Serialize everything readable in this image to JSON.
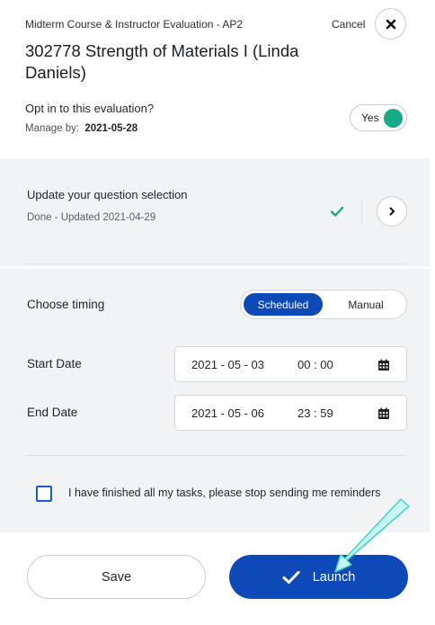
{
  "header": {
    "evaluation_name": "Midterm Course & Instructor Evaluation - AP2",
    "cancel_label": "Cancel",
    "close_icon": "close-icon",
    "course_title": "302778 Strength of Materials I (Linda Daniels)",
    "optin_question": "Opt in to this evaluation?",
    "manage_by_label": "Manage by:",
    "manage_by_date": "2021-05-28",
    "optin_toggle_label": "Yes",
    "optin_toggle_on": true
  },
  "question_selection": {
    "title": "Update your question selection",
    "status": "Done - Updated 2021-04-29",
    "status_icon": "check-icon",
    "nav_icon": "chevron-right-icon"
  },
  "timing": {
    "label": "Choose timing",
    "options": [
      "Scheduled",
      "Manual"
    ],
    "selected": "Scheduled"
  },
  "start": {
    "label": "Start Date",
    "date": "2021 - 05 - 03",
    "time": "00 : 00"
  },
  "end": {
    "label": "End Date",
    "date": "2021 - 05 - 06",
    "time": "23 : 59"
  },
  "reminder": {
    "label": "I have finished all my tasks, please stop sending me reminders",
    "checked": false
  },
  "footer": {
    "save_label": "Save",
    "launch_label": "Launch"
  },
  "colors": {
    "primary": "#0e49b8",
    "toggle_on": "#18a987",
    "check_green": "#18a987",
    "panel_gray": "#f2f3f5",
    "annotation_arrow": "#5fe6d8"
  }
}
